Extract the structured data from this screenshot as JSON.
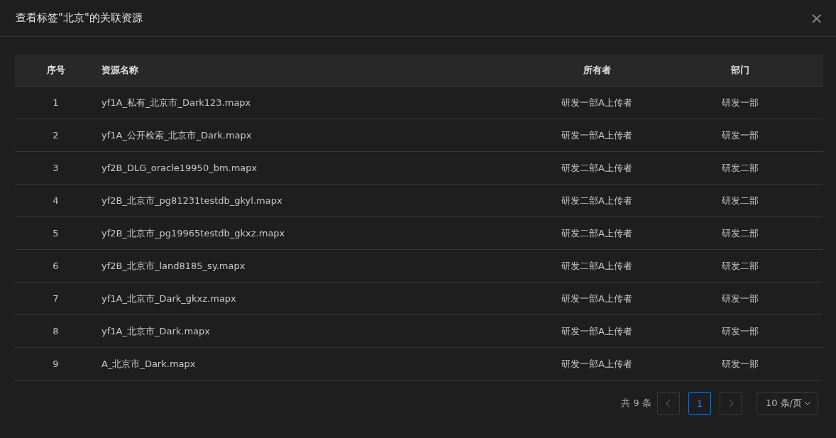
{
  "dialog": {
    "title": "查看标签\"北京\"的关联资源",
    "close": "×"
  },
  "table": {
    "columns": [
      "序号",
      "资源名称",
      "所有者",
      "部门"
    ],
    "rows": [
      {
        "index": "1",
        "name": "yf1A_私有_北京市_Dark123.mapx",
        "owner": "研发一部A上传者",
        "department": "研发一部"
      },
      {
        "index": "2",
        "name": "yf1A_公开检索_北京市_Dark.mapx",
        "owner": "研发一部A上传者",
        "department": "研发一部"
      },
      {
        "index": "3",
        "name": "yf2B_DLG_oracle19950_bm.mapx",
        "owner": "研发二部A上传者",
        "department": "研发二部"
      },
      {
        "index": "4",
        "name": "yf2B_北京市_pg81231testdb_gkyl.mapx",
        "owner": "研发二部A上传者",
        "department": "研发二部"
      },
      {
        "index": "5",
        "name": "yf2B_北京市_pg19965testdb_gkxz.mapx",
        "owner": "研发二部A上传者",
        "department": "研发二部"
      },
      {
        "index": "6",
        "name": "yf2B_北京市_land8185_sy.mapx",
        "owner": "研发二部A上传者",
        "department": "研发二部"
      },
      {
        "index": "7",
        "name": "yf1A_北京市_Dark_gkxz.mapx",
        "owner": "研发一部A上传者",
        "department": "研发一部"
      },
      {
        "index": "8",
        "name": "yf1A_北京市_Dark.mapx",
        "owner": "研发一部A上传者",
        "department": "研发一部"
      },
      {
        "index": "9",
        "name": "A_北京市_Dark.mapx",
        "owner": "研发一部A上传者",
        "department": "研发一部"
      }
    ]
  },
  "pagination": {
    "total": "共 9 条",
    "prev_disabled": true,
    "next_disabled": true,
    "pages": [
      {
        "label": "1",
        "selected": true
      }
    ],
    "page_size": "10 条/页"
  }
}
